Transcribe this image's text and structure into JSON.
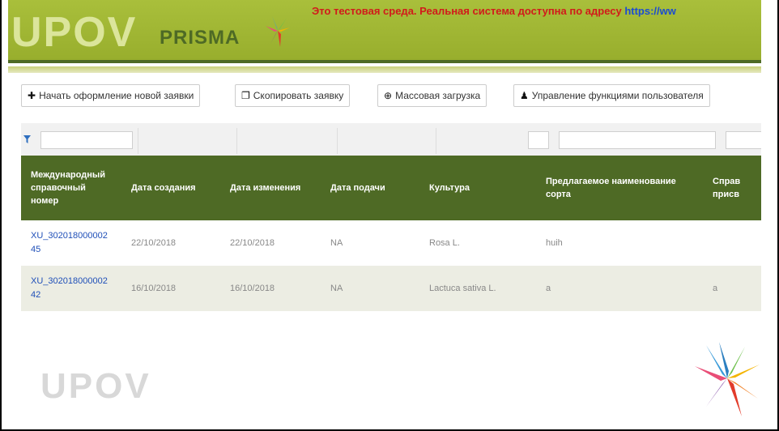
{
  "header": {
    "logo_main": "UPOV",
    "logo_sub": "PRISMA",
    "test_notice": "Это тестовая среда. Реальная система доступна по адресу ",
    "test_link": "https://ww"
  },
  "toolbar": {
    "new_app": {
      "label": "Начать оформление новой заявки",
      "icon": "plus-icon"
    },
    "copy_app": {
      "label": "Скопировать заявку",
      "icon": "copy-icon"
    },
    "bulk_upload": {
      "label": "Массовая загрузка",
      "icon": "upload-icon"
    },
    "user_roles": {
      "label": "Управление функциями пользователя",
      "icon": "user-icon"
    }
  },
  "filter": {
    "icon": "funnel-icon"
  },
  "table": {
    "columns": [
      "Международный справочный номер",
      "Дата создания",
      "Дата изменения",
      "Дата подачи",
      "Культура",
      "Предлагаемое наименование сорта",
      "Справ присв"
    ],
    "rows": [
      {
        "id": "XU_30201800000245",
        "created": "22/10/2018",
        "modified": "22/10/2018",
        "filed": "NA",
        "crop": "Rosa L.",
        "denomination": "huih",
        "ref": ""
      },
      {
        "id": "XU_30201800000242",
        "created": "16/10/2018",
        "modified": "16/10/2018",
        "filed": "NA",
        "crop": "Lactuca sativa L.",
        "denomination": "a",
        "ref": "a"
      }
    ]
  },
  "footer": {
    "logo": "UPOV"
  },
  "colors": {
    "header_green": "#a9bf3b",
    "dark_green": "#4e6a25",
    "alert_red": "#d11b1b",
    "link_blue": "#1f4fb8"
  }
}
